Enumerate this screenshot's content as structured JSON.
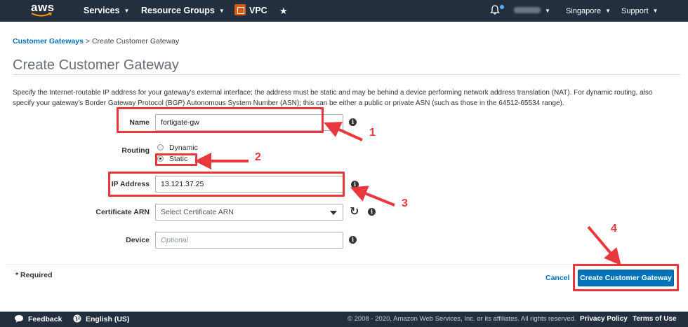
{
  "nav": {
    "logo": "aws",
    "services": "Services",
    "resource_groups": "Resource Groups",
    "service_name": "VPC",
    "region": "Singapore",
    "support": "Support"
  },
  "breadcrumb": {
    "parent": "Customer Gateways",
    "separator": ">",
    "current": "Create Customer Gateway"
  },
  "page": {
    "title": "Create Customer Gateway",
    "description": "Specify the Internet-routable IP address for your gateway's external interface; the address must be static and may be behind a device performing network address translation (NAT). For dynamic routing, also specify your gateway's Border Gateway Protocol (BGP) Autonomous System Number (ASN); this can be either a public or private ASN (such as those in the 64512-65534 range)."
  },
  "form": {
    "name": {
      "label": "Name",
      "value": "fortigate-gw"
    },
    "routing": {
      "label": "Routing",
      "options": [
        "Dynamic",
        "Static"
      ],
      "selected": "Static"
    },
    "ip_address": {
      "label": "IP Address",
      "value": "13.121.37.25"
    },
    "certificate_arn": {
      "label": "Certificate ARN",
      "placeholder": "Select Certificate ARN"
    },
    "device": {
      "label": "Device",
      "placeholder": "Optional"
    }
  },
  "actions": {
    "required_note": "* Required",
    "cancel": "Cancel",
    "submit": "Create Customer Gateway"
  },
  "footer": {
    "feedback": "Feedback",
    "language": "English (US)",
    "copyright": "© 2008 - 2020, Amazon Web Services, Inc. or its affiliates. All rights reserved.",
    "privacy": "Privacy Policy",
    "terms": "Terms of Use"
  },
  "annotations": {
    "step1": "1",
    "step2": "2",
    "step3": "3",
    "step4": "4",
    "color": "#e8383d"
  },
  "colors": {
    "nav_bg": "#232f3e",
    "link": "#0073bb",
    "primary": "#0073bb",
    "service_icon": "#d05c17"
  }
}
